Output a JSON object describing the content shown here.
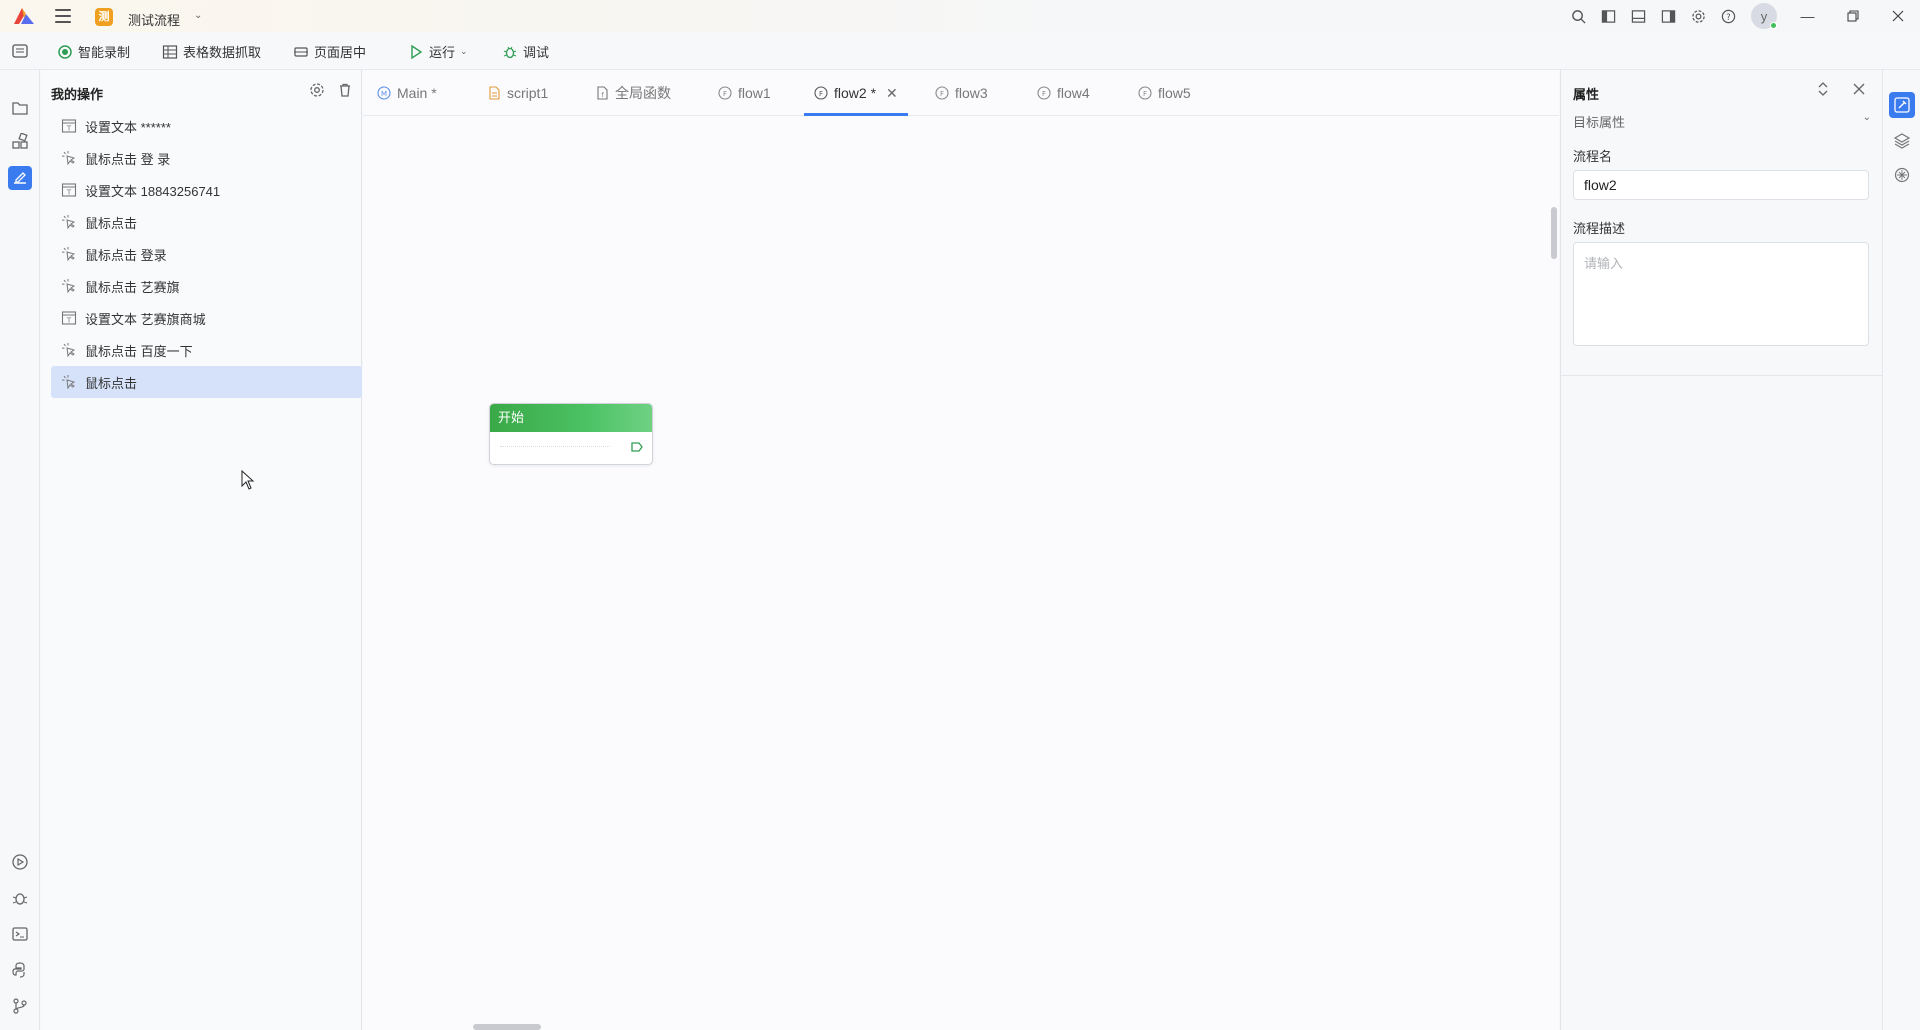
{
  "titlebar": {
    "project_badge": "测",
    "project_name": "测试流程",
    "avatar_letter": "y"
  },
  "toolbar": {
    "smart_record": "智能录制",
    "table_capture": "表格数据抓取",
    "page_center": "页面居中",
    "run": "运行",
    "debug": "调试"
  },
  "ops_panel": {
    "title": "我的操作",
    "items": [
      {
        "icon": "set-text-icon",
        "label": "设置文本 ******"
      },
      {
        "icon": "mouse-click-icon",
        "label": "鼠标点击 登 录"
      },
      {
        "icon": "set-text-icon",
        "label": "设置文本 18843256741"
      },
      {
        "icon": "mouse-click-icon",
        "label": "鼠标点击"
      },
      {
        "icon": "mouse-click-icon",
        "label": "鼠标点击 登录"
      },
      {
        "icon": "mouse-click-icon",
        "label": "鼠标点击 艺赛旗"
      },
      {
        "icon": "set-text-icon",
        "label": "设置文本 艺赛旗商城"
      },
      {
        "icon": "mouse-click-icon",
        "label": "鼠标点击 百度一下"
      },
      {
        "icon": "mouse-click-icon",
        "label": "鼠标点击"
      }
    ],
    "selected_index": 8
  },
  "tabs": [
    {
      "icon": "main-icon",
      "label": "Main *"
    },
    {
      "icon": "script-icon",
      "label": "script1"
    },
    {
      "icon": "global-func-icon",
      "label": "全局函数"
    },
    {
      "icon": "flow-icon",
      "label": "flow1"
    },
    {
      "icon": "flow-icon",
      "label": "flow2 *"
    },
    {
      "icon": "flow-icon",
      "label": "flow3"
    },
    {
      "icon": "flow-icon",
      "label": "flow4"
    },
    {
      "icon": "flow-icon",
      "label": "flow5"
    }
  ],
  "active_tab": 4,
  "canvas": {
    "start_node_label": "开始"
  },
  "properties": {
    "title": "属性",
    "section": "目标属性",
    "flow_name_label": "流程名",
    "flow_name_value": "flow2",
    "flow_desc_label": "流程描述",
    "flow_desc_placeholder": "请输入"
  },
  "colors": {
    "accent": "#3b7bf0",
    "start_node_green": "#4cc264",
    "project_badge": "#f0a020",
    "selected_row": "#d6e2f9"
  }
}
